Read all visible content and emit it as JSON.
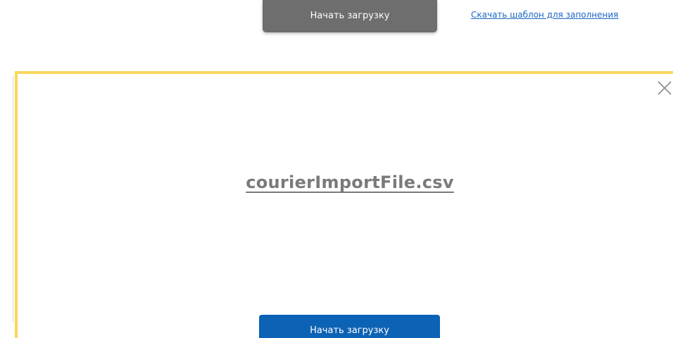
{
  "header": {
    "start_upload_label": "Начать загрузку",
    "download_template_link": "Скачать шаблон для заполнения"
  },
  "dialog": {
    "close_icon": "close-icon",
    "file_name": "courierImportFile.csv",
    "start_upload_label": "Начать загрузку"
  },
  "colors": {
    "top_button_bg": "#6e6e6e",
    "link_color": "#1a66c2",
    "dialog_border": "#f8d75c",
    "file_name_color": "#7a7a7a",
    "primary_button_bg": "#0c62b5"
  }
}
